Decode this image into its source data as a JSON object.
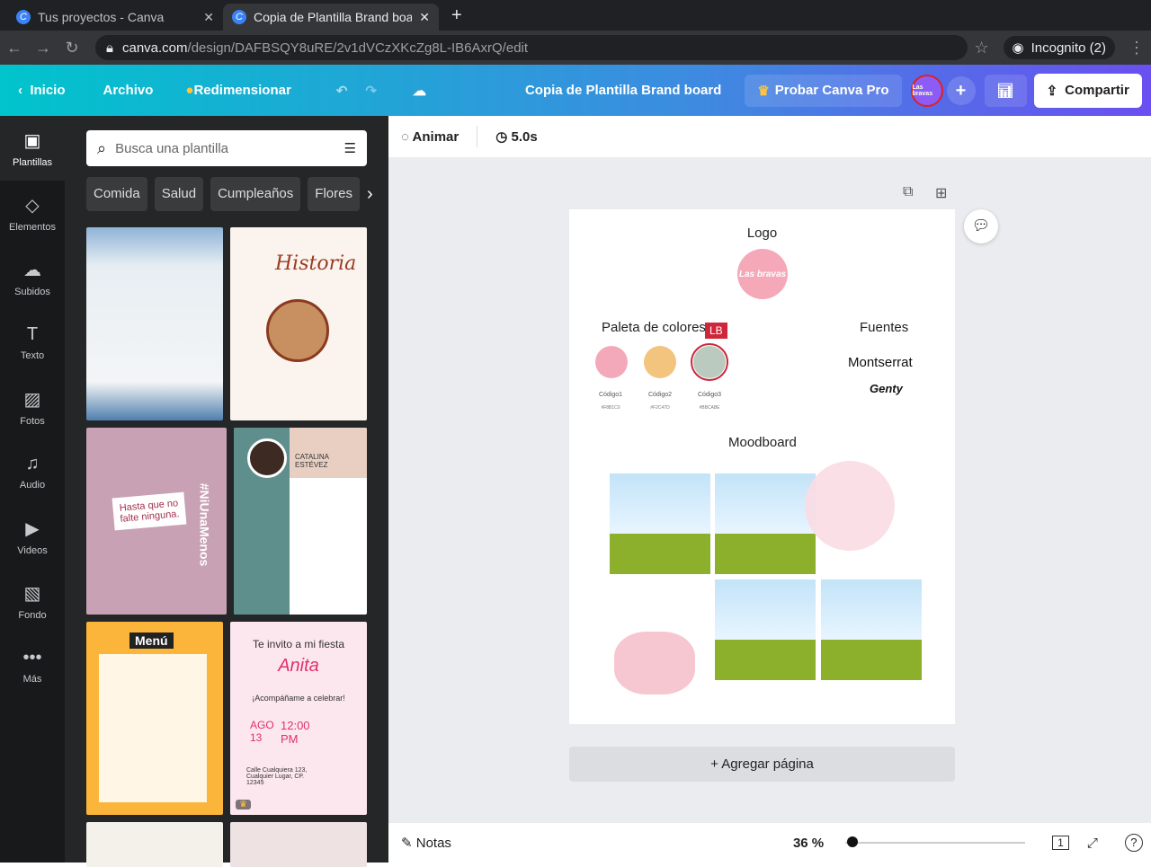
{
  "browser": {
    "tabs": [
      {
        "title": "Tus proyectos - Canva"
      },
      {
        "title": "Copia de Plantilla Brand board"
      }
    ],
    "url_host": "canva.com",
    "url_path": "/design/DAFBSQY8uRE/2v1dVCzXKcZg8L-IB6AxrQ/edit",
    "incognito": "Incognito (2)"
  },
  "topbar": {
    "home": "Inicio",
    "file": "Archivo",
    "resize": "Redimensionar",
    "doc_title": "Copia de Plantilla Brand board",
    "try_pro": "Probar Canva Pro",
    "share": "Compartir",
    "avatar_text": "Las bravas"
  },
  "rail": [
    {
      "label": "Plantillas",
      "icon": "template-icon"
    },
    {
      "label": "Elementos",
      "icon": "elements-icon"
    },
    {
      "label": "Subidos",
      "icon": "upload-icon"
    },
    {
      "label": "Texto",
      "icon": "text-icon"
    },
    {
      "label": "Fotos",
      "icon": "photo-icon"
    },
    {
      "label": "Audio",
      "icon": "audio-icon"
    },
    {
      "label": "Videos",
      "icon": "video-icon"
    },
    {
      "label": "Fondo",
      "icon": "background-icon"
    },
    {
      "label": "Más",
      "icon": "more-icon"
    }
  ],
  "panel": {
    "search_placeholder": "Busca una plantilla",
    "chips": [
      "Comida",
      "Salud",
      "Cumpleaños",
      "Flores"
    ],
    "templates": {
      "historia": "Historia",
      "niunamenos_sign": "Hasta que no falte ninguna.",
      "niunamenos_tag": "#NiUnaMenos",
      "cv_name": "CATALINA ESTÉVEZ",
      "menu": "Menú",
      "party_title": "Te invito a mi fiesta",
      "party_name": "Anita",
      "party_sub": "¡Acompáñame a celebrar!",
      "party_date": "AGO 13",
      "party_time": "12:00 PM",
      "party_addr": "Calle Cualquiera 123, Cualquier Lugar, CP. 12345"
    }
  },
  "toolbar": {
    "animate": "Animar",
    "duration": "5.0s"
  },
  "design": {
    "logo_title": "Logo",
    "logo_text": "Las bravas",
    "palette_title": "Paleta de colores",
    "fonts_title": "Fuentes",
    "font1": "Montserrat",
    "font2": "Genty",
    "moodboard_title": "Moodboard",
    "collab_badge": "LB",
    "swatches": [
      {
        "label": "Código1",
        "hex": "#F8B1C0",
        "color": "#f4a9ba"
      },
      {
        "label": "Código2",
        "hex": "#F2C47D",
        "color": "#f2c47d"
      },
      {
        "label": "Código3",
        "hex": "#BBCABE",
        "color": "#bbcabe"
      }
    ]
  },
  "add_page": "+ Agregar página",
  "footer": {
    "notes": "Notas",
    "zoom": "36 %",
    "page_count": "1"
  }
}
